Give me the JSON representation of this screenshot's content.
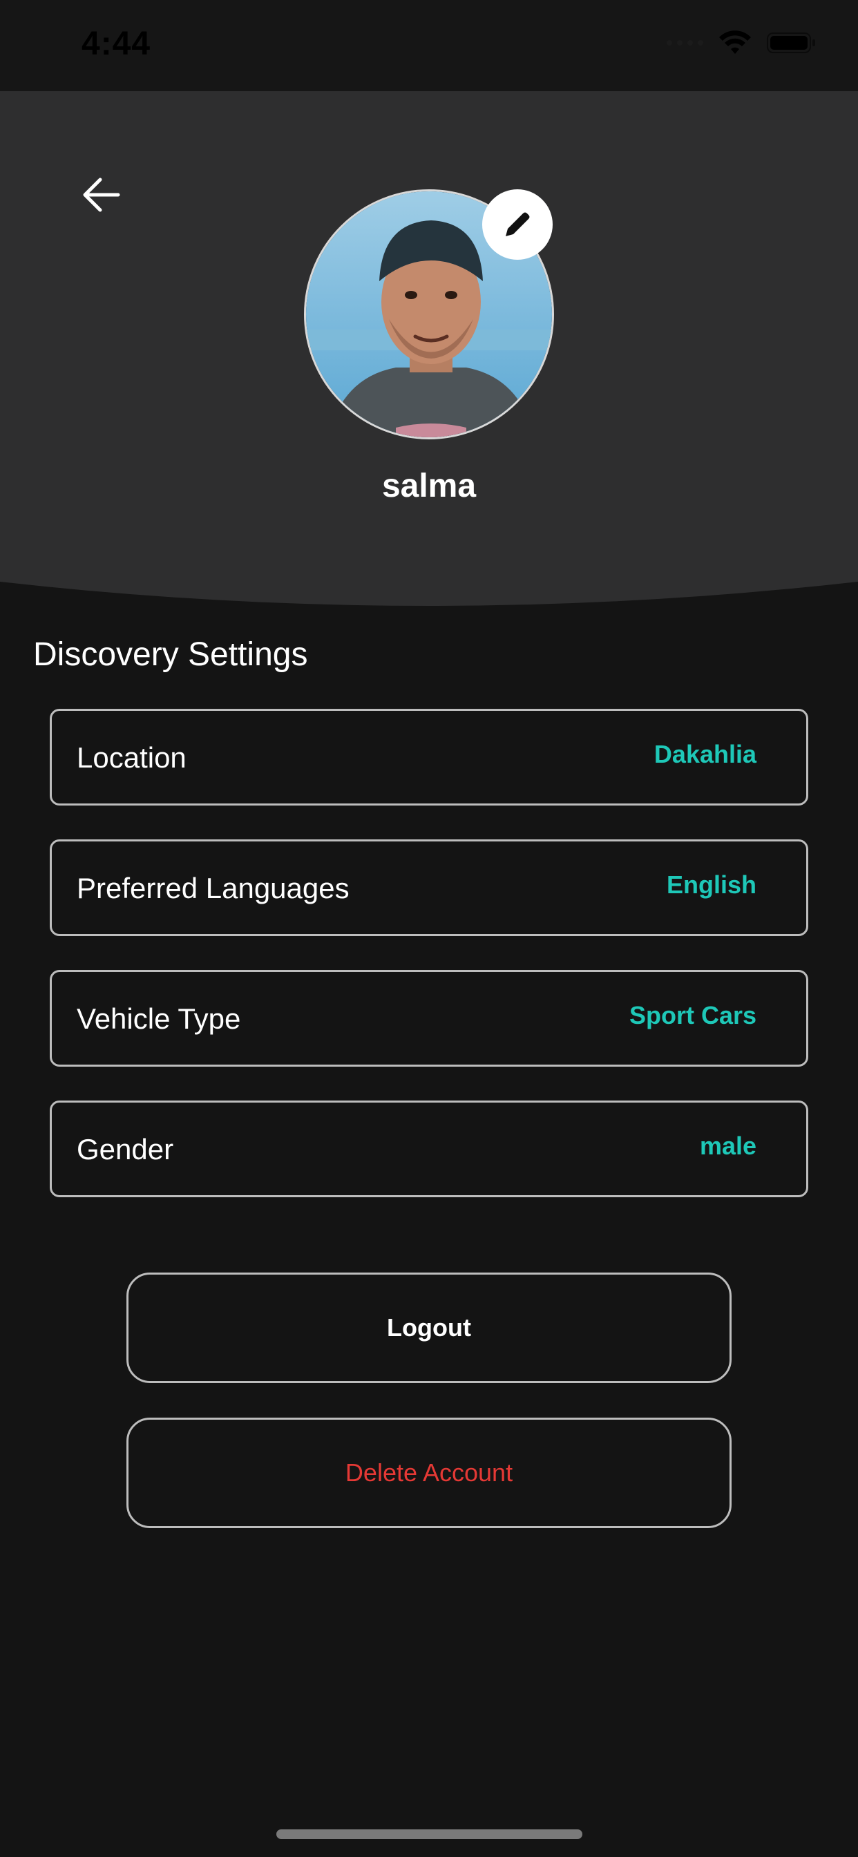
{
  "status_bar": {
    "time": "4:44",
    "signal_icon": "signal-icon",
    "wifi_icon": "wifi-icon",
    "battery_icon": "battery-icon"
  },
  "header": {
    "back_icon": "arrow-left-icon",
    "edit_icon": "pencil-icon",
    "avatar": "profile-photo",
    "name": "salma"
  },
  "discovery": {
    "title": "Discovery Settings",
    "items": [
      {
        "label": "Location",
        "value": "Dakahlia"
      },
      {
        "label": "Preferred Languages",
        "value": "English"
      },
      {
        "label": "Vehicle Type",
        "value": "Sport Cars"
      },
      {
        "label": "Gender",
        "value": "male"
      }
    ]
  },
  "actions": {
    "logout_label": "Logout",
    "delete_label": "Delete Account"
  },
  "colors": {
    "background": "#141414",
    "header": "#2e2e2f",
    "accent": "#1ec8b8",
    "danger": "#e53935"
  }
}
